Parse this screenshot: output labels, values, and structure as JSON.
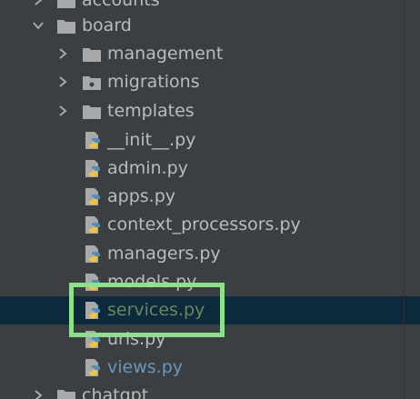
{
  "project_tree": {
    "items": [
      {
        "label": "accounts",
        "kind": "folder",
        "state": "collapsed"
      },
      {
        "label": "board",
        "kind": "folder",
        "state": "expanded"
      },
      {
        "label": "management",
        "kind": "folder",
        "state": "collapsed"
      },
      {
        "label": "migrations",
        "kind": "package",
        "state": "collapsed"
      },
      {
        "label": "templates",
        "kind": "folder",
        "state": "collapsed"
      },
      {
        "label": "__init__.py",
        "kind": "python-file"
      },
      {
        "label": "admin.py",
        "kind": "python-file"
      },
      {
        "label": "apps.py",
        "kind": "python-file"
      },
      {
        "label": "context_processors.py",
        "kind": "python-file"
      },
      {
        "label": "managers.py",
        "kind": "python-file"
      },
      {
        "label": "models.py",
        "kind": "python-file"
      },
      {
        "label": "services.py",
        "kind": "python-file",
        "selected": true,
        "status": "modified"
      },
      {
        "label": "urls.py",
        "kind": "python-file"
      },
      {
        "label": "views.py",
        "kind": "python-file",
        "status": "changed"
      },
      {
        "label": "chatgpt",
        "kind": "folder",
        "state": "collapsed"
      }
    ]
  },
  "colors": {
    "panel_background": "#3c3f41",
    "selection_background": "#0d293e",
    "default_text": "#bbbbbb",
    "modified_text": "#6a8759",
    "changed_text": "#6897bb",
    "folder_icon": "#a9a9a9",
    "annotation_box": "#8be28b"
  }
}
